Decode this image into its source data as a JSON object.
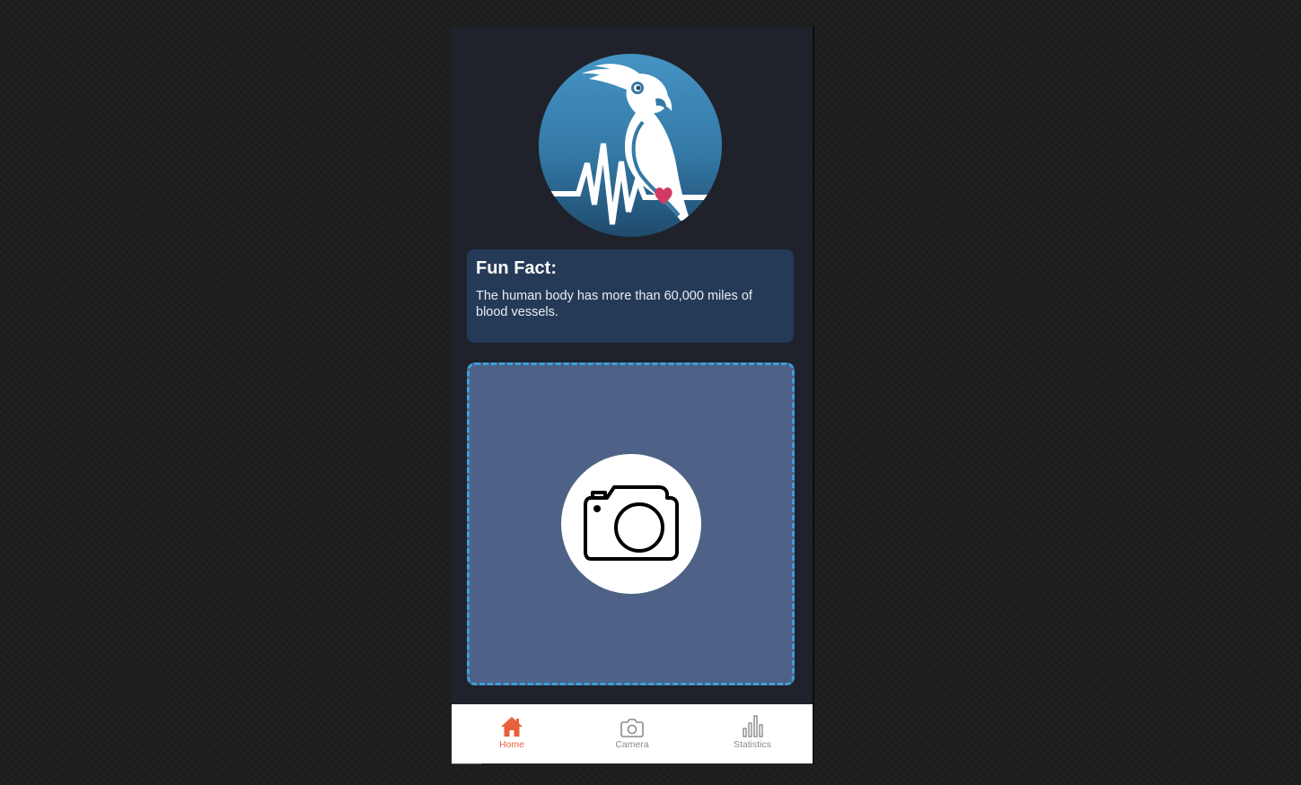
{
  "fun_fact": {
    "title": "Fun Fact:",
    "text": "The human body has more than 60,000 miles of blood vessels."
  },
  "logo": {
    "icon": "parrot-heartbeat-logo",
    "colors": {
      "top": "#4593c4",
      "bottom": "#1f4a6c",
      "heart": "#d23a64"
    }
  },
  "upload": {
    "icon": "camera-icon"
  },
  "tabs": [
    {
      "label": "Home",
      "icon": "home-icon",
      "active": true
    },
    {
      "label": "Camera",
      "icon": "camera-icon",
      "active": false
    },
    {
      "label": "Statistics",
      "icon": "bar-chart-icon",
      "active": false
    }
  ],
  "colors": {
    "accent": "#e8613c",
    "card": "#253a57",
    "upload_zone": "#4d6286",
    "dash": "#3b9fe0",
    "app_background": "#1f222a"
  }
}
